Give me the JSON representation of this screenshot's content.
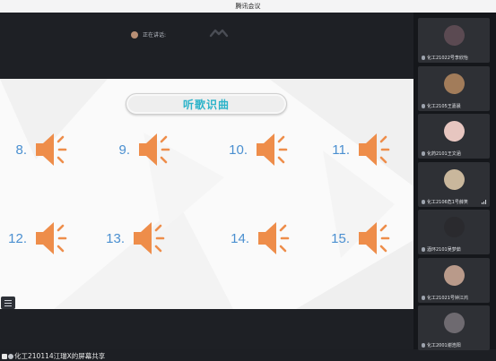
{
  "app": {
    "title": "腾讯会议"
  },
  "speaking": {
    "label": "正在讲话:"
  },
  "slide": {
    "title": "听歌识曲",
    "songs": [
      {
        "num": "8."
      },
      {
        "num": "9."
      },
      {
        "num": "10."
      },
      {
        "num": "11."
      },
      {
        "num": "12."
      },
      {
        "num": "13."
      },
      {
        "num": "14."
      },
      {
        "num": "15."
      }
    ]
  },
  "share": {
    "label": "化工210114江瑞X的屏幕共享"
  },
  "participants": [
    {
      "name": "化工21022号李欣怡",
      "avatar_color": "#5b4a52"
    },
    {
      "name": "化工2105王嘉晨",
      "avatar_color": "#a27c5a"
    },
    {
      "name": "化药2101王文涵",
      "avatar_color": "#e7c6c0"
    },
    {
      "name": "化工2106危1号薛笑",
      "avatar_color": "#c9b79c"
    },
    {
      "name": "酒环2101吴梦茹",
      "avatar_color": "#2a2a2e"
    },
    {
      "name": "化工21021号钟江鸿",
      "avatar_color": "#b99a8a"
    },
    {
      "name": "化工2001谢浩阳",
      "avatar_color": "#6e6a70"
    }
  ],
  "colors": {
    "accent_title": "#2bb3c9",
    "number": "#4a8fd0",
    "speaker": "#ee8d4a"
  }
}
